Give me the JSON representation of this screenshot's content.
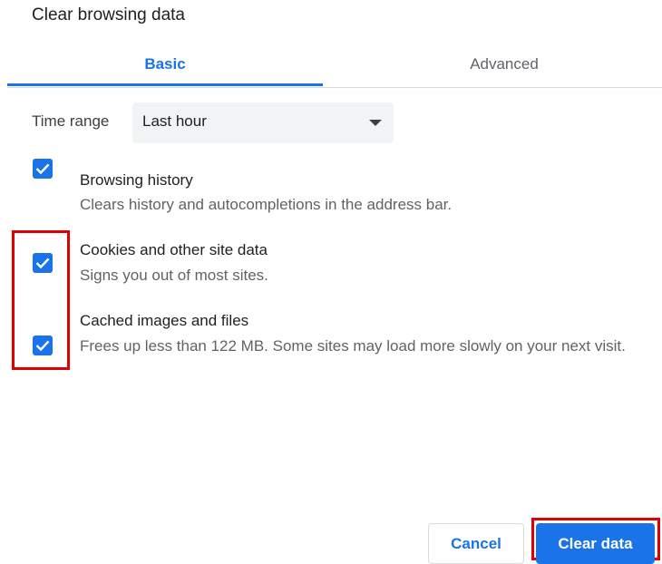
{
  "dialog": {
    "title": "Clear browsing data"
  },
  "tabs": [
    {
      "label": "Basic",
      "selected": true
    },
    {
      "label": "Advanced",
      "selected": false
    }
  ],
  "time_range": {
    "label": "Time range",
    "value": "Last hour"
  },
  "options": [
    {
      "title": "Browsing history",
      "description": "Clears history and autocompletions in the address bar.",
      "checked": true
    },
    {
      "title": "Cookies and other site data",
      "description": "Signs you out of most sites.",
      "checked": true
    },
    {
      "title": "Cached images and files",
      "description": "Frees up less than 122 MB. Some sites may load more slowly on your next visit.",
      "checked": true
    }
  ],
  "buttons": {
    "cancel": "Cancel",
    "clear": "Clear data"
  },
  "colors": {
    "accent": "#1a73e8",
    "highlight": "#e00000",
    "select_bg": "#f1f3f4"
  },
  "icons": {
    "checkbox": "checkmark-icon",
    "dropdown": "caret-down-icon"
  }
}
